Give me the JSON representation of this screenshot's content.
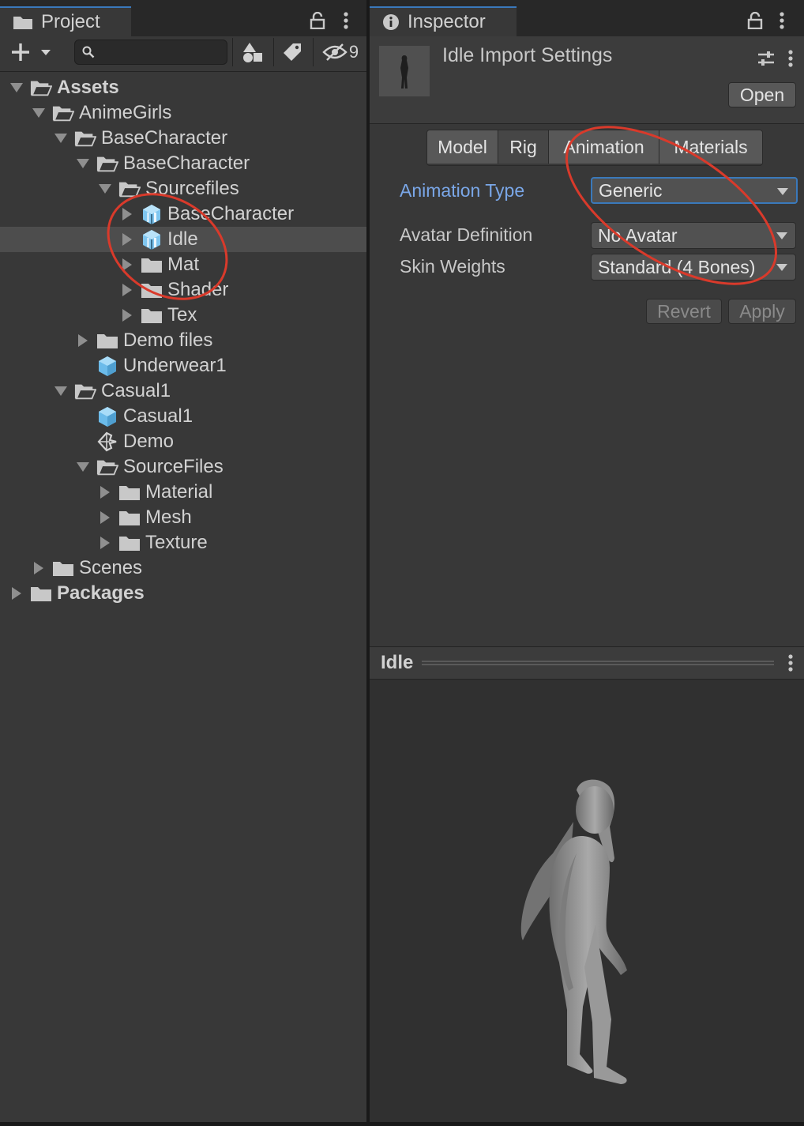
{
  "project": {
    "tab_label": "Project",
    "search_placeholder": "",
    "hidden_count": "9",
    "tree": [
      {
        "label": "Assets",
        "depth": 0,
        "expanded": true,
        "icon": "folder-open-icon",
        "bold": true
      },
      {
        "label": "AnimeGirls",
        "depth": 1,
        "expanded": true,
        "icon": "folder-open-icon"
      },
      {
        "label": "BaseCharacter",
        "depth": 2,
        "expanded": true,
        "icon": "folder-open-icon"
      },
      {
        "label": "BaseCharacter",
        "depth": 3,
        "expanded": true,
        "icon": "folder-open-icon"
      },
      {
        "label": "Sourcefiles",
        "depth": 4,
        "expanded": true,
        "icon": "folder-open-icon"
      },
      {
        "label": "BaseCharacter",
        "depth": 5,
        "expanded": false,
        "icon": "model-prefab-icon"
      },
      {
        "label": "Idle",
        "depth": 5,
        "expanded": false,
        "icon": "model-prefab-icon",
        "selected": true
      },
      {
        "label": "Mat",
        "depth": 5,
        "expanded": false,
        "icon": "folder-icon"
      },
      {
        "label": "Shader",
        "depth": 5,
        "expanded": false,
        "icon": "folder-icon"
      },
      {
        "label": "Tex",
        "depth": 5,
        "expanded": false,
        "icon": "folder-icon"
      },
      {
        "label": "Demo files",
        "depth": 3,
        "expanded": false,
        "icon": "folder-icon"
      },
      {
        "label": "Underwear1",
        "depth": 3,
        "leaf": true,
        "icon": "prefab-cube-icon"
      },
      {
        "label": "Casual1",
        "depth": 2,
        "expanded": true,
        "icon": "folder-open-icon"
      },
      {
        "label": "Casual1",
        "depth": 3,
        "leaf": true,
        "icon": "prefab-cube-icon"
      },
      {
        "label": "Demo",
        "depth": 3,
        "leaf": true,
        "icon": "unity-scene-icon"
      },
      {
        "label": "SourceFiles",
        "depth": 3,
        "expanded": true,
        "icon": "folder-open-icon"
      },
      {
        "label": "Material",
        "depth": 4,
        "expanded": false,
        "icon": "folder-icon"
      },
      {
        "label": "Mesh",
        "depth": 4,
        "expanded": false,
        "icon": "folder-icon"
      },
      {
        "label": "Texture",
        "depth": 4,
        "expanded": false,
        "icon": "folder-icon"
      },
      {
        "label": "Scenes",
        "depth": 1,
        "expanded": false,
        "icon": "folder-icon"
      },
      {
        "label": "Packages",
        "depth": 0,
        "expanded": false,
        "icon": "folder-icon",
        "bold": true
      }
    ]
  },
  "inspector": {
    "tab_label": "Inspector",
    "title": "Idle Import Settings",
    "open_label": "Open",
    "tabs": [
      {
        "label": "Model",
        "active": false
      },
      {
        "label": "Rig",
        "active": true
      },
      {
        "label": "Animation",
        "active": false
      },
      {
        "label": "Materials",
        "active": false
      }
    ],
    "fields": [
      {
        "label": "Animation Type",
        "value": "Generic"
      },
      {
        "label": "Avatar Definition",
        "value": "No Avatar"
      },
      {
        "label": "Skin Weights",
        "value": "Standard (4 Bones)"
      }
    ],
    "revert_label": "Revert",
    "apply_label": "Apply",
    "preview_title": "Idle"
  },
  "colors": {
    "accent": "#3a79bb",
    "annotation": "#d93a2b",
    "prefab": "#7fc6f0"
  }
}
